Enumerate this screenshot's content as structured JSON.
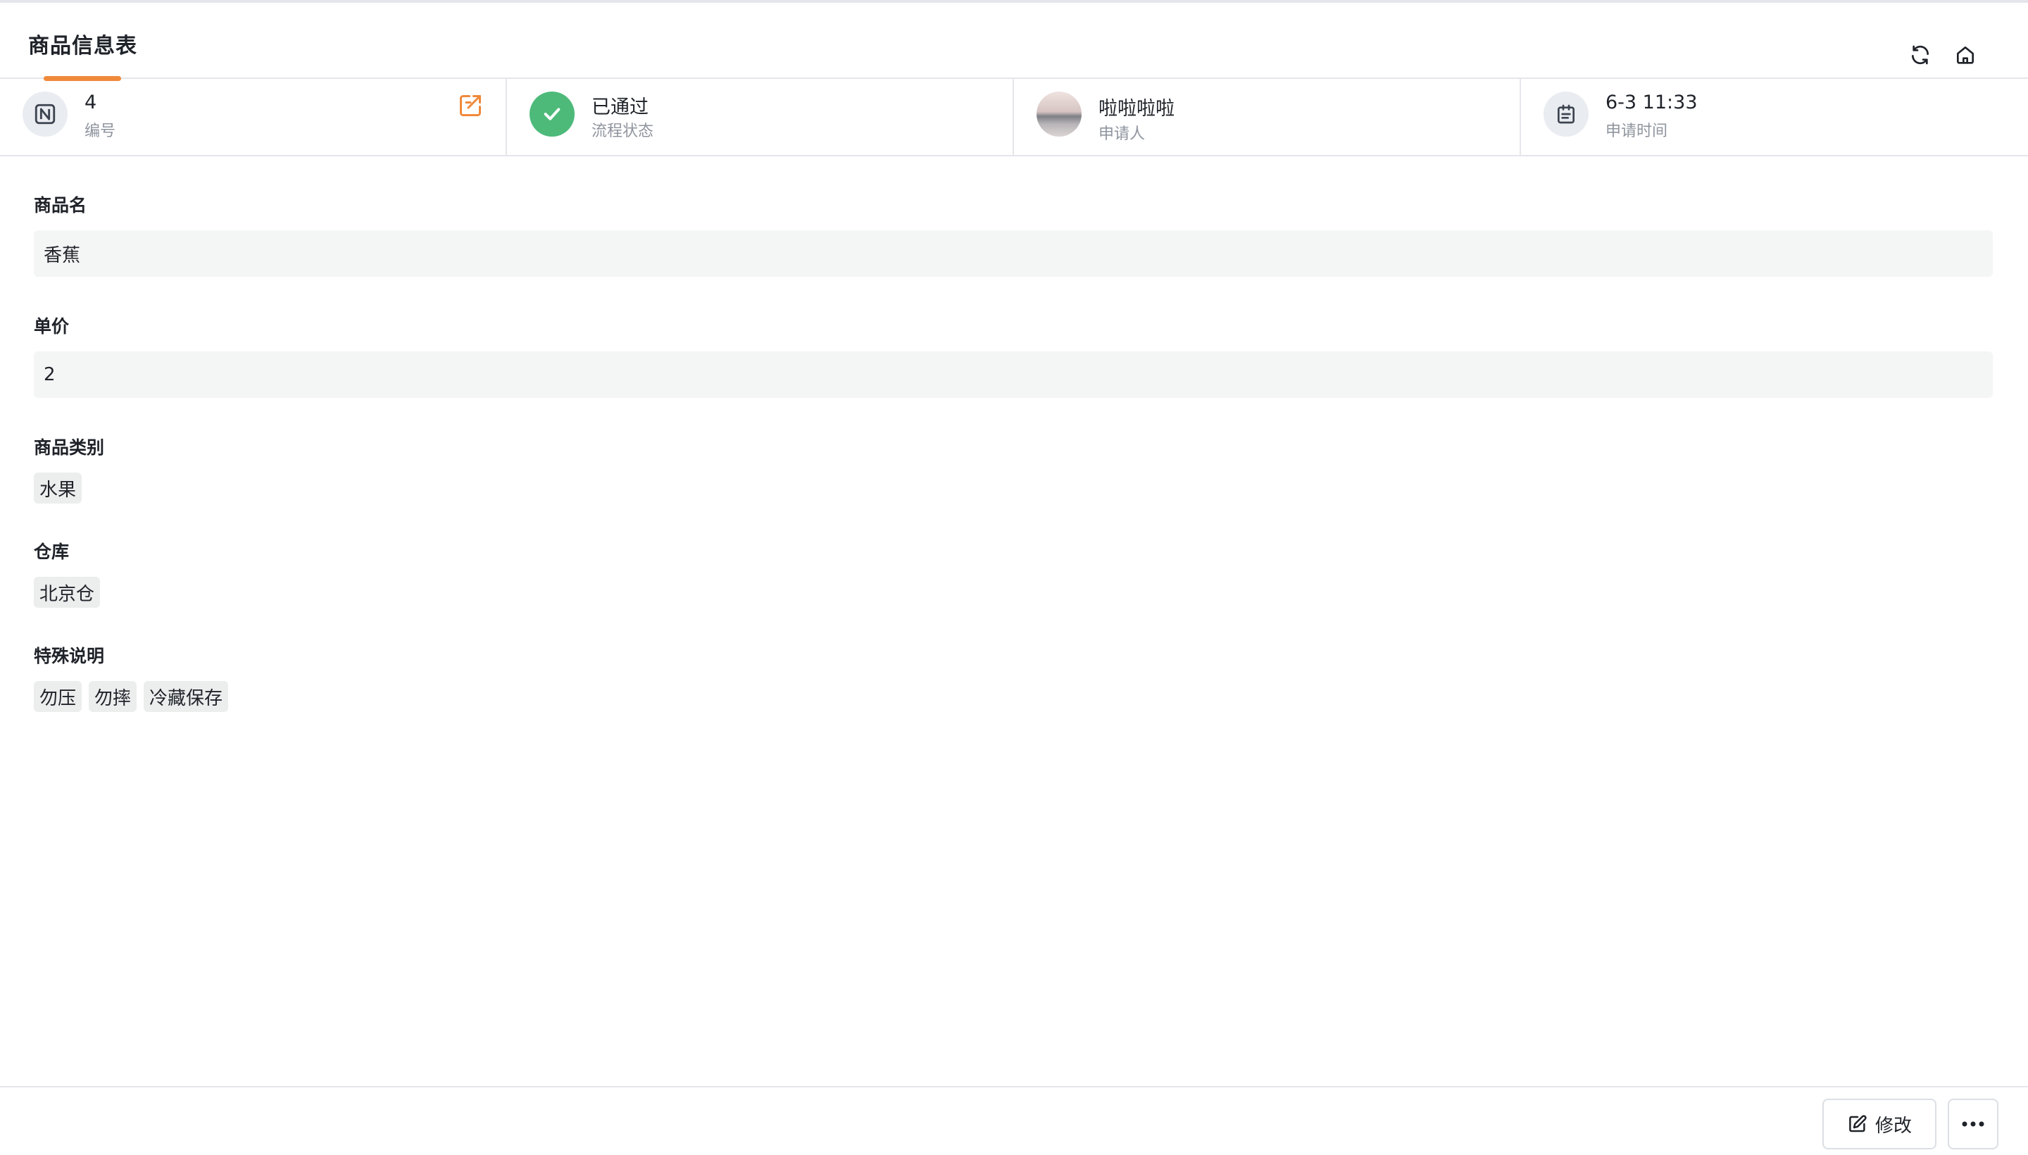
{
  "header": {
    "title": "商品信息表",
    "actions": [
      {
        "icon": "refresh-icon"
      },
      {
        "icon": "home-icon"
      }
    ]
  },
  "info_bar": {
    "id": {
      "value": "4",
      "label": "编号",
      "icon": "n-square-icon",
      "link_icon": "external-link-icon"
    },
    "status": {
      "value": "已通过",
      "label": "流程状态",
      "icon": "check-icon",
      "color": "#4dba7a"
    },
    "applicant": {
      "value": "啦啦啦啦",
      "label": "申请人",
      "icon": "avatar"
    },
    "time": {
      "value": "6-3 11:33",
      "label": "申请时间",
      "icon": "calendar-icon"
    }
  },
  "form": {
    "product_name": {
      "label": "商品名",
      "value": "香蕉"
    },
    "unit_price": {
      "label": "单价",
      "value": "2"
    },
    "category": {
      "label": "商品类别",
      "tags": [
        "水果"
      ]
    },
    "warehouse": {
      "label": "仓库",
      "tags": [
        "北京仓"
      ]
    },
    "special_notes": {
      "label": "特殊说明",
      "tags": [
        "勿压",
        "勿摔",
        "冷藏保存"
      ]
    }
  },
  "footer": {
    "edit_label": "修改",
    "edit_icon": "edit-icon",
    "more_icon": "more-icon"
  },
  "colors": {
    "accent": "#f0893a",
    "success": "#4dba7a"
  }
}
